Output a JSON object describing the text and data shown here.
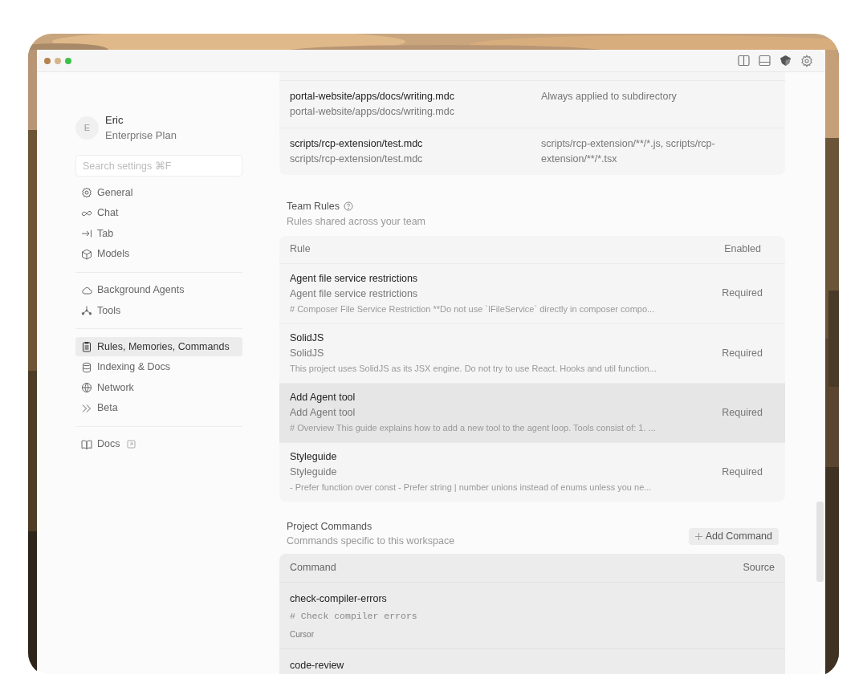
{
  "user": {
    "initial": "E",
    "name": "Eric",
    "plan": "Enterprise Plan"
  },
  "search": {
    "placeholder": "Search settings ⌘F"
  },
  "sidebar": {
    "groups": [
      {
        "items": [
          {
            "label": "General",
            "selected": false
          },
          {
            "label": "Chat",
            "selected": false
          },
          {
            "label": "Tab",
            "selected": false
          },
          {
            "label": "Models",
            "selected": false
          }
        ]
      },
      {
        "items": [
          {
            "label": "Background Agents",
            "selected": false
          },
          {
            "label": "Tools",
            "selected": false
          }
        ]
      },
      {
        "items": [
          {
            "label": "Rules, Memories, Commands",
            "selected": true
          },
          {
            "label": "Indexing & Docs",
            "selected": false
          },
          {
            "label": "Network",
            "selected": false
          },
          {
            "label": "Beta",
            "selected": false
          }
        ]
      },
      {
        "items": [
          {
            "label": "Docs",
            "selected": false,
            "external": true
          }
        ]
      }
    ]
  },
  "project_rules": {
    "rows": [
      {
        "name": "portal-website/apps/docs/writing.mdc",
        "path": "portal-website/apps/docs/writing.mdc",
        "applies": "Always applied to subdirectory"
      },
      {
        "name": "scripts/rcp-extension/test.mdc",
        "path": "scripts/rcp-extension/test.mdc",
        "applies": "scripts/rcp-extension/**/*.js, scripts/rcp-extension/**/*.tsx"
      }
    ]
  },
  "team_rules": {
    "title": "Team Rules",
    "subtitle": "Rules shared across your team",
    "columns": [
      "Rule",
      "Enabled"
    ],
    "rows": [
      {
        "name": "Agent file service restrictions",
        "description": "Agent file service restrictions",
        "preview": "# Composer File Service Restriction **Do not use `IFileService` directly in composer compo...",
        "enabled": "Required",
        "selected": false
      },
      {
        "name": "SolidJS",
        "description": "SolidJS",
        "preview": "This project uses SolidJS as its JSX engine. Do not try to use React. Hooks and util function...",
        "enabled": "Required",
        "selected": false
      },
      {
        "name": "Add Agent tool",
        "description": "Add Agent tool",
        "preview": "# Overview This guide explains how to add a new tool to the agent loop. Tools consist of: 1. ...",
        "enabled": "Required",
        "selected": true
      },
      {
        "name": "Styleguide",
        "description": "Styleguide",
        "preview": "- Prefer function over const - Prefer string | number unions instead of enums unless you ne...",
        "enabled": "Required",
        "selected": false
      }
    ]
  },
  "project_commands": {
    "title": "Project Commands",
    "subtitle": "Commands specific to this workspace",
    "add_button": "Add Command",
    "columns": [
      "Command",
      "Source"
    ],
    "rows": [
      {
        "name": "check-compiler-errors",
        "content": "# Check compiler errors",
        "source": "Cursor"
      },
      {
        "name": "code-review"
      }
    ]
  }
}
